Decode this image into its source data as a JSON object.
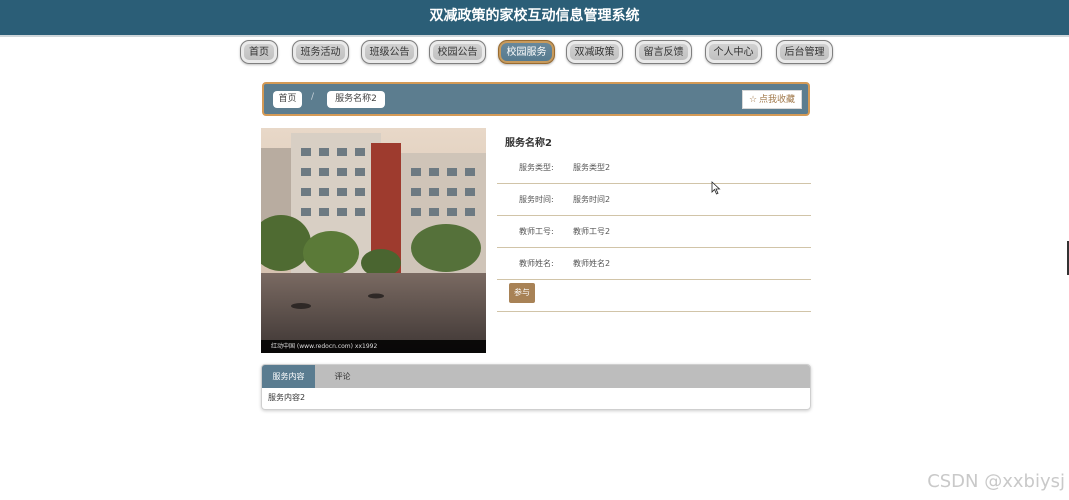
{
  "header": {
    "title": "双减政策的家校互动信息管理系统"
  },
  "nav": {
    "items": [
      {
        "label": "首页"
      },
      {
        "label": "班务活动"
      },
      {
        "label": "班级公告"
      },
      {
        "label": "校园公告"
      },
      {
        "label": "校园服务"
      },
      {
        "label": "双减政策"
      },
      {
        "label": "留言反馈"
      },
      {
        "label": "个人中心"
      },
      {
        "label": "后台管理"
      }
    ],
    "active_index": 4
  },
  "breadcrumb": {
    "home": "首页",
    "separator": "/",
    "current": "服务名称2",
    "favorite_label": "点我收藏"
  },
  "photo": {
    "caption": "红动中国 (www.redocn.com)    xx1992"
  },
  "detail": {
    "title": "服务名称2",
    "fields": [
      {
        "label": "服务类型:",
        "value": "服务类型2"
      },
      {
        "label": "服务时间:",
        "value": "服务时间2"
      },
      {
        "label": "教师工号:",
        "value": "教师工号2"
      },
      {
        "label": "教师姓名:",
        "value": "教师姓名2"
      }
    ],
    "join_label": "参与"
  },
  "tabs": {
    "items": [
      {
        "label": "服务内容"
      },
      {
        "label": "评论"
      }
    ],
    "active_index": 0,
    "content": "服务内容2"
  },
  "watermark": "CSDN @xxbiysj",
  "colors": {
    "header_bg": "#2b5e77",
    "accent_brown": "#a88256",
    "breadcrumb_bg": "#5c7d8f",
    "breadcrumb_border": "#d49a56"
  }
}
